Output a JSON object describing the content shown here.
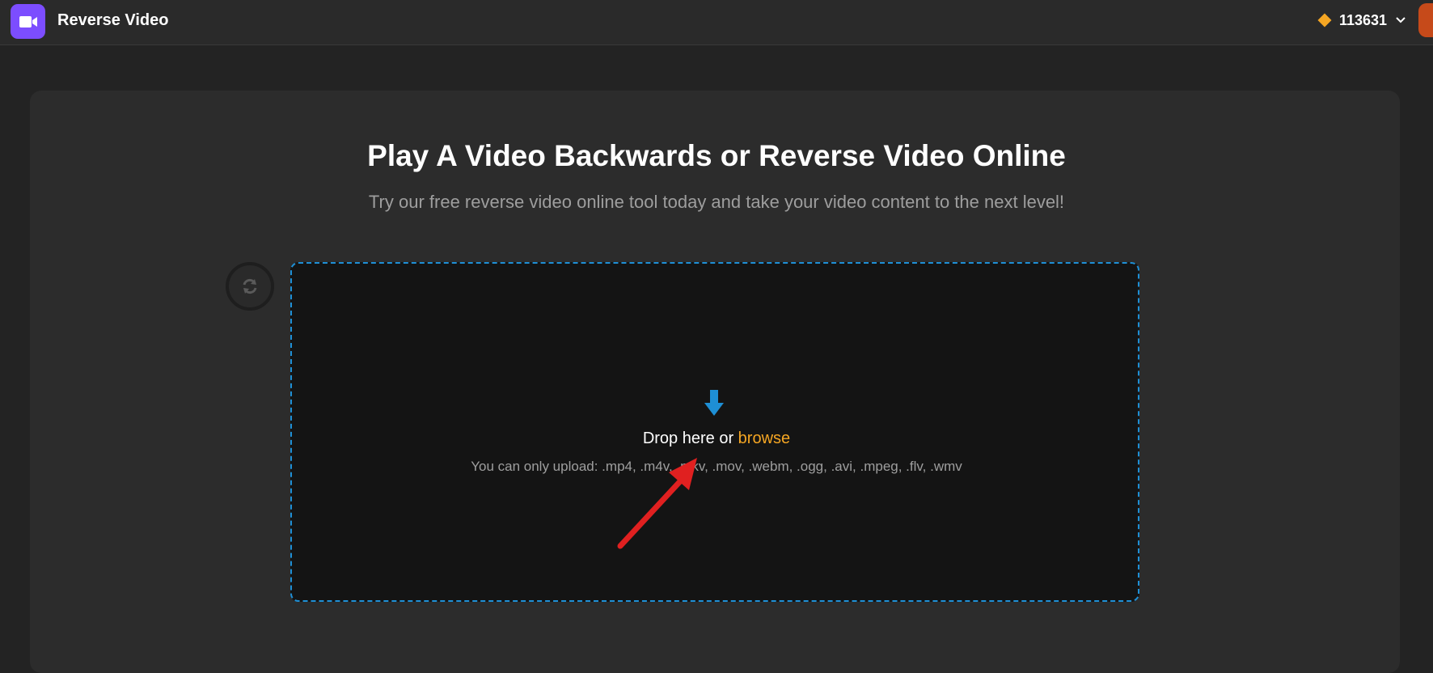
{
  "header": {
    "app_icon": "video-camera-icon",
    "app_title": "Reverse Video",
    "credits": {
      "icon": "diamond-icon",
      "value": "113631",
      "dropdown_icon": "chevron-down-icon"
    }
  },
  "main": {
    "title": "Play A Video Backwards or Reverse Video Online",
    "subtitle": "Try our free reverse video online tool today and take your video content to the next level!",
    "refresh_icon": "refresh-icon",
    "upload": {
      "icon": "download-arrow-icon",
      "drop_text": "Drop here or ",
      "browse_label": "browse",
      "formats_text": "You can only upload: .mp4, .m4v, .mkv, .mov, .webm, .ogg, .avi, .mpeg, .flv, .wmv"
    }
  },
  "colors": {
    "accent": "#7c4dff",
    "browse": "#f5a623",
    "dropzone_border": "#1e8fd5",
    "annotation": "#e02020"
  }
}
